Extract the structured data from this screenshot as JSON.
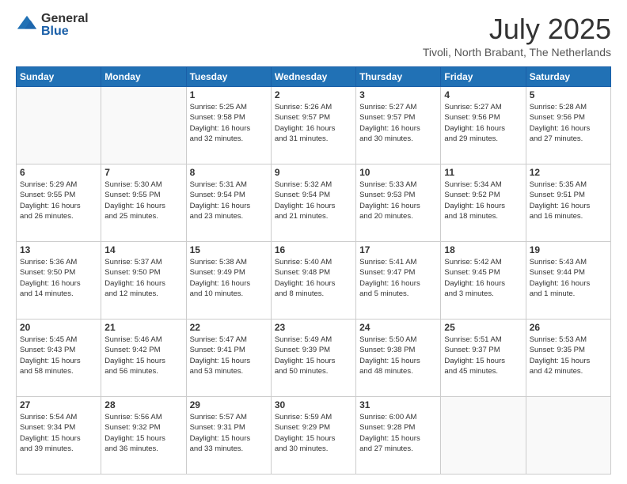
{
  "header": {
    "logo_general": "General",
    "logo_blue": "Blue",
    "month_year": "July 2025",
    "location": "Tivoli, North Brabant, The Netherlands"
  },
  "days_of_week": [
    "Sunday",
    "Monday",
    "Tuesday",
    "Wednesday",
    "Thursday",
    "Friday",
    "Saturday"
  ],
  "weeks": [
    [
      {
        "day": "",
        "info": ""
      },
      {
        "day": "",
        "info": ""
      },
      {
        "day": "1",
        "info": "Sunrise: 5:25 AM\nSunset: 9:58 PM\nDaylight: 16 hours\nand 32 minutes."
      },
      {
        "day": "2",
        "info": "Sunrise: 5:26 AM\nSunset: 9:57 PM\nDaylight: 16 hours\nand 31 minutes."
      },
      {
        "day": "3",
        "info": "Sunrise: 5:27 AM\nSunset: 9:57 PM\nDaylight: 16 hours\nand 30 minutes."
      },
      {
        "day": "4",
        "info": "Sunrise: 5:27 AM\nSunset: 9:56 PM\nDaylight: 16 hours\nand 29 minutes."
      },
      {
        "day": "5",
        "info": "Sunrise: 5:28 AM\nSunset: 9:56 PM\nDaylight: 16 hours\nand 27 minutes."
      }
    ],
    [
      {
        "day": "6",
        "info": "Sunrise: 5:29 AM\nSunset: 9:55 PM\nDaylight: 16 hours\nand 26 minutes."
      },
      {
        "day": "7",
        "info": "Sunrise: 5:30 AM\nSunset: 9:55 PM\nDaylight: 16 hours\nand 25 minutes."
      },
      {
        "day": "8",
        "info": "Sunrise: 5:31 AM\nSunset: 9:54 PM\nDaylight: 16 hours\nand 23 minutes."
      },
      {
        "day": "9",
        "info": "Sunrise: 5:32 AM\nSunset: 9:54 PM\nDaylight: 16 hours\nand 21 minutes."
      },
      {
        "day": "10",
        "info": "Sunrise: 5:33 AM\nSunset: 9:53 PM\nDaylight: 16 hours\nand 20 minutes."
      },
      {
        "day": "11",
        "info": "Sunrise: 5:34 AM\nSunset: 9:52 PM\nDaylight: 16 hours\nand 18 minutes."
      },
      {
        "day": "12",
        "info": "Sunrise: 5:35 AM\nSunset: 9:51 PM\nDaylight: 16 hours\nand 16 minutes."
      }
    ],
    [
      {
        "day": "13",
        "info": "Sunrise: 5:36 AM\nSunset: 9:50 PM\nDaylight: 16 hours\nand 14 minutes."
      },
      {
        "day": "14",
        "info": "Sunrise: 5:37 AM\nSunset: 9:50 PM\nDaylight: 16 hours\nand 12 minutes."
      },
      {
        "day": "15",
        "info": "Sunrise: 5:38 AM\nSunset: 9:49 PM\nDaylight: 16 hours\nand 10 minutes."
      },
      {
        "day": "16",
        "info": "Sunrise: 5:40 AM\nSunset: 9:48 PM\nDaylight: 16 hours\nand 8 minutes."
      },
      {
        "day": "17",
        "info": "Sunrise: 5:41 AM\nSunset: 9:47 PM\nDaylight: 16 hours\nand 5 minutes."
      },
      {
        "day": "18",
        "info": "Sunrise: 5:42 AM\nSunset: 9:45 PM\nDaylight: 16 hours\nand 3 minutes."
      },
      {
        "day": "19",
        "info": "Sunrise: 5:43 AM\nSunset: 9:44 PM\nDaylight: 16 hours\nand 1 minute."
      }
    ],
    [
      {
        "day": "20",
        "info": "Sunrise: 5:45 AM\nSunset: 9:43 PM\nDaylight: 15 hours\nand 58 minutes."
      },
      {
        "day": "21",
        "info": "Sunrise: 5:46 AM\nSunset: 9:42 PM\nDaylight: 15 hours\nand 56 minutes."
      },
      {
        "day": "22",
        "info": "Sunrise: 5:47 AM\nSunset: 9:41 PM\nDaylight: 15 hours\nand 53 minutes."
      },
      {
        "day": "23",
        "info": "Sunrise: 5:49 AM\nSunset: 9:39 PM\nDaylight: 15 hours\nand 50 minutes."
      },
      {
        "day": "24",
        "info": "Sunrise: 5:50 AM\nSunset: 9:38 PM\nDaylight: 15 hours\nand 48 minutes."
      },
      {
        "day": "25",
        "info": "Sunrise: 5:51 AM\nSunset: 9:37 PM\nDaylight: 15 hours\nand 45 minutes."
      },
      {
        "day": "26",
        "info": "Sunrise: 5:53 AM\nSunset: 9:35 PM\nDaylight: 15 hours\nand 42 minutes."
      }
    ],
    [
      {
        "day": "27",
        "info": "Sunrise: 5:54 AM\nSunset: 9:34 PM\nDaylight: 15 hours\nand 39 minutes."
      },
      {
        "day": "28",
        "info": "Sunrise: 5:56 AM\nSunset: 9:32 PM\nDaylight: 15 hours\nand 36 minutes."
      },
      {
        "day": "29",
        "info": "Sunrise: 5:57 AM\nSunset: 9:31 PM\nDaylight: 15 hours\nand 33 minutes."
      },
      {
        "day": "30",
        "info": "Sunrise: 5:59 AM\nSunset: 9:29 PM\nDaylight: 15 hours\nand 30 minutes."
      },
      {
        "day": "31",
        "info": "Sunrise: 6:00 AM\nSunset: 9:28 PM\nDaylight: 15 hours\nand 27 minutes."
      },
      {
        "day": "",
        "info": ""
      },
      {
        "day": "",
        "info": ""
      }
    ]
  ]
}
